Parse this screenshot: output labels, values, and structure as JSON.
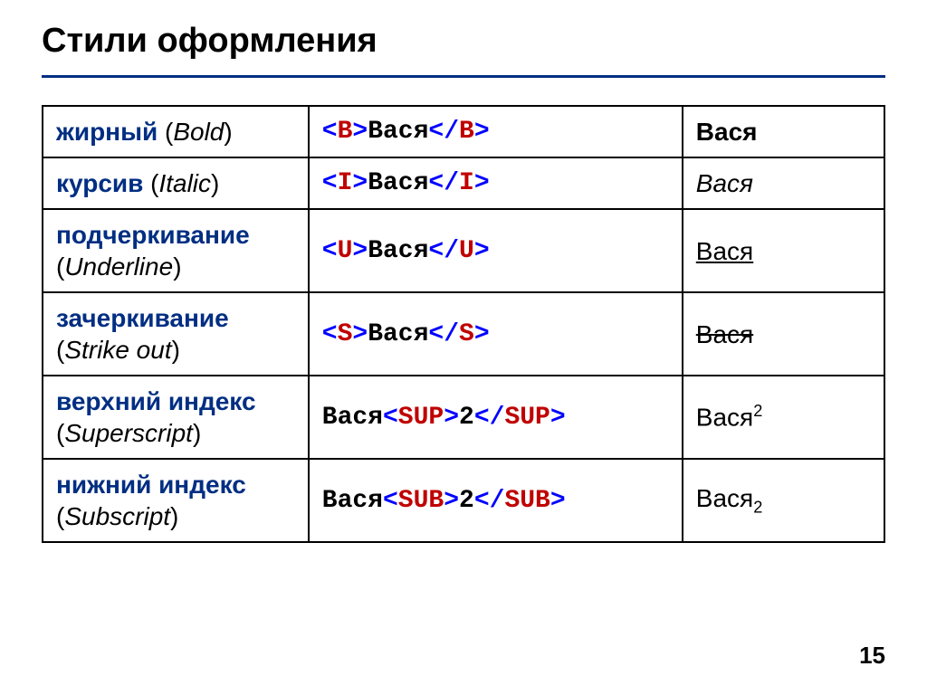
{
  "title": "Стили оформления",
  "pageNumber": "15",
  "rows": [
    {
      "ru": "жирный",
      "en": "Bold",
      "code": {
        "lt1": "<",
        "tag1": "B",
        "gt1": ">",
        "text": "Вася",
        "lt2": "</",
        "tag2": "B",
        "gt2": ">"
      },
      "render": {
        "kind": "bold",
        "text": "Вася"
      }
    },
    {
      "ru": "курсив",
      "en": "Italic",
      "code": {
        "lt1": "<",
        "tag1": "I",
        "gt1": ">",
        "text": "Вася",
        "lt2": "</",
        "tag2": "I",
        "gt2": ">"
      },
      "render": {
        "kind": "italic",
        "text": "Вася"
      }
    },
    {
      "ru": "подчеркивание",
      "en": "Underline",
      "code": {
        "lt1": "<",
        "tag1": "U",
        "gt1": ">",
        "text": "Вася",
        "lt2": "</",
        "tag2": "U",
        "gt2": ">"
      },
      "render": {
        "kind": "underline",
        "text": "Вася"
      }
    },
    {
      "ru": "зачеркивание",
      "en": "Strike out",
      "code": {
        "lt1": "<",
        "tag1": "S",
        "gt1": ">",
        "text": "Вася",
        "lt2": "</",
        "tag2": "S",
        "gt2": ">"
      },
      "render": {
        "kind": "strike",
        "text": "Вася"
      }
    },
    {
      "ru": "верхний индекс",
      "en": "Superscript",
      "code": {
        "pre": "Вася",
        "lt1": "<",
        "tag1": "SUP",
        "gt1": ">",
        "text": "2",
        "lt2": "</",
        "tag2": "SUP",
        "gt2": ">"
      },
      "render": {
        "kind": "sup",
        "base": "Вася",
        "exp": "2"
      }
    },
    {
      "ru": "нижний индекс",
      "en": "Subscript",
      "code": {
        "pre": "Вася",
        "lt1": "<",
        "tag1": "SUB",
        "gt1": ">",
        "text": "2",
        "lt2": "</",
        "tag2": "SUB",
        "gt2": ">"
      },
      "render": {
        "kind": "sub",
        "base": "Вася",
        "exp": "2"
      }
    }
  ]
}
